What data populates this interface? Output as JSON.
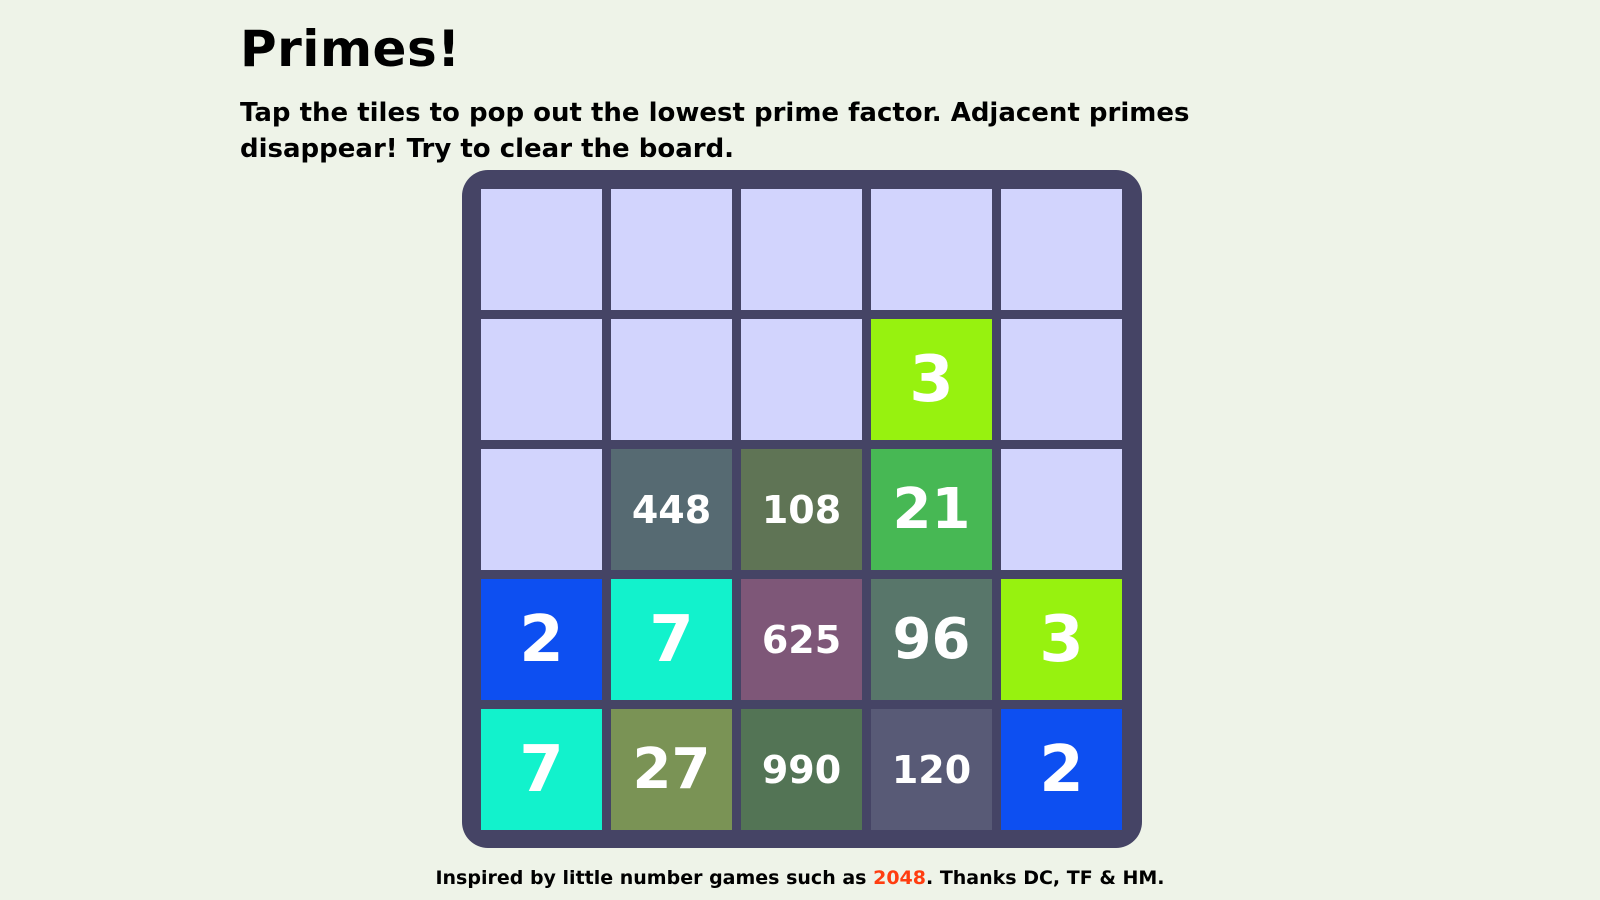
{
  "title": "Primes!",
  "instructions": "Tap the tiles to pop out the lowest prime factor. Adjacent primes disappear! Try to clear the board.",
  "colors": {
    "background": "#eef3e8",
    "board": "#454465",
    "empty_tile": "#d2d4fd",
    "tile_text": "#ffffff",
    "link": "#ff3d10"
  },
  "board": {
    "rows": [
      [
        {
          "value": "",
          "color": ""
        },
        {
          "value": "",
          "color": ""
        },
        {
          "value": "",
          "color": ""
        },
        {
          "value": "",
          "color": ""
        },
        {
          "value": "",
          "color": ""
        }
      ],
      [
        {
          "value": "",
          "color": ""
        },
        {
          "value": "",
          "color": ""
        },
        {
          "value": "",
          "color": ""
        },
        {
          "value": "3",
          "color": "#97f20f"
        },
        {
          "value": "",
          "color": ""
        }
      ],
      [
        {
          "value": "",
          "color": ""
        },
        {
          "value": "448",
          "color": "#566a72"
        },
        {
          "value": "108",
          "color": "#5f7455"
        },
        {
          "value": "21",
          "color": "#47b854"
        },
        {
          "value": "",
          "color": ""
        }
      ],
      [
        {
          "value": "2",
          "color": "#0d4ff1"
        },
        {
          "value": "7",
          "color": "#12f2cc"
        },
        {
          "value": "625",
          "color": "#7e5778"
        },
        {
          "value": "96",
          "color": "#58766a"
        },
        {
          "value": "3",
          "color": "#97f20f"
        }
      ],
      [
        {
          "value": "7",
          "color": "#12f2cc"
        },
        {
          "value": "27",
          "color": "#7a9355"
        },
        {
          "value": "990",
          "color": "#537455"
        },
        {
          "value": "120",
          "color": "#585a76"
        },
        {
          "value": "2",
          "color": "#0d4ff1"
        }
      ]
    ]
  },
  "footer": {
    "before": "Inspired by little number games such as ",
    "link_text": "2048",
    "after": ". Thanks DC, TF & HM."
  }
}
